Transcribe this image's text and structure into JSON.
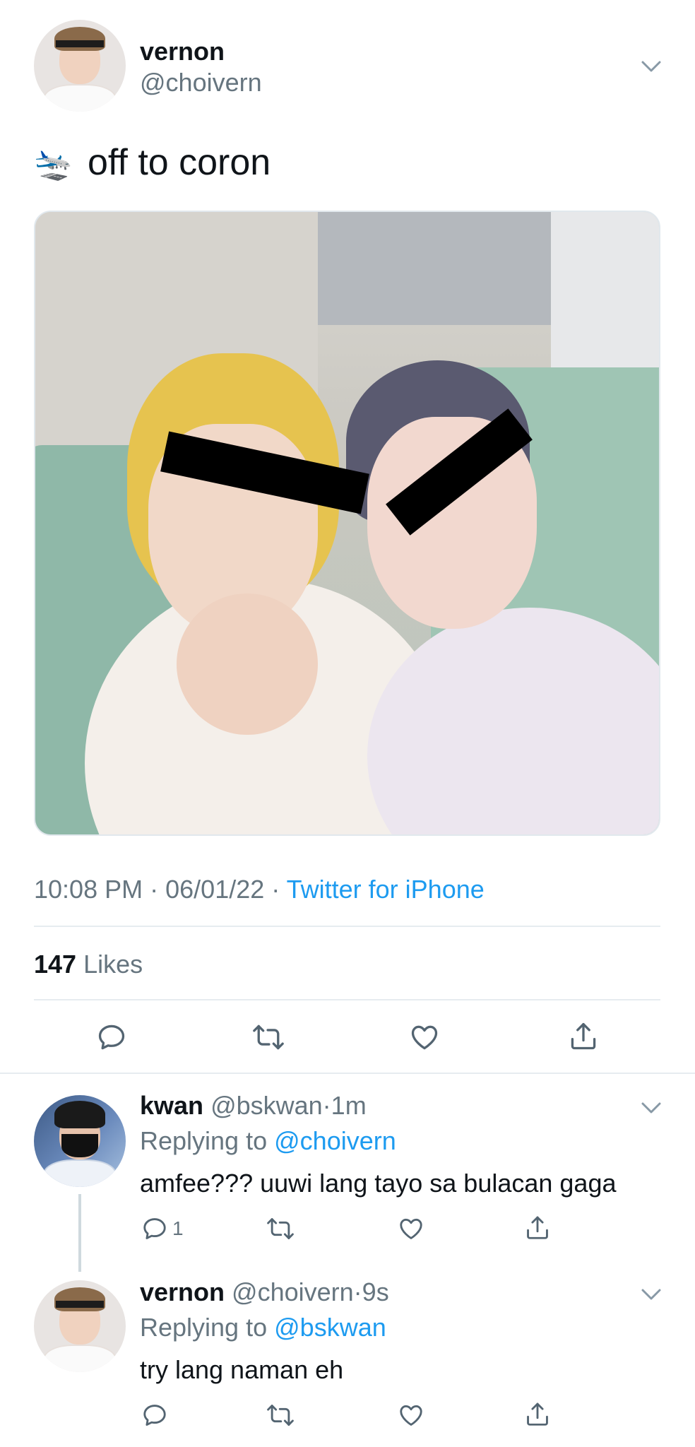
{
  "tweet": {
    "author_name": "vernon",
    "author_handle": "@choivern",
    "emoji": "🛬",
    "text": "off to coron",
    "time": "10:08 PM",
    "date": "06/01/22",
    "source": "Twitter for iPhone",
    "likes_count": "147",
    "likes_label": "Likes"
  },
  "replies": [
    {
      "name": "kwan",
      "handle": "@bskwan",
      "time": "1m",
      "replying_prefix": "Replying to",
      "replying_to": "@choivern",
      "text": "amfee??? uuwi lang tayo sa bulacan gaga",
      "reply_count": "1"
    },
    {
      "name": "vernon",
      "handle": "@choivern",
      "time": "9s",
      "replying_prefix": "Replying to",
      "replying_to": "@bskwan",
      "text": "try lang naman eh",
      "reply_count": ""
    }
  ],
  "separator": "·",
  "icons": {
    "reply": "reply-icon",
    "retweet": "retweet-icon",
    "like": "heart-icon",
    "share": "share-icon",
    "more": "chevron-down-icon"
  },
  "colors": {
    "link": "#1d9bf0",
    "secondary_text": "#66757f",
    "divider": "#e6ecf0"
  }
}
